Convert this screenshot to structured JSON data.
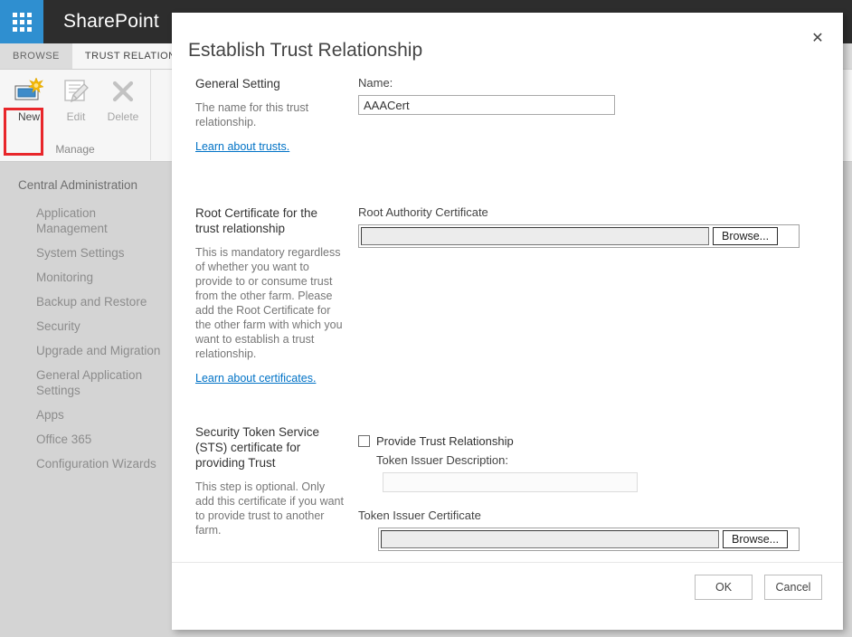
{
  "suite_bar": {
    "app_launcher_icon": "waffle-grid-icon",
    "brand": "SharePoint"
  },
  "ribbon": {
    "tabs": [
      {
        "label": "BROWSE",
        "active": false
      },
      {
        "label": "TRUST RELATIONSHIP",
        "active": true
      }
    ],
    "group_label": "Manage",
    "buttons": [
      {
        "label": "New",
        "icon": "new-item-icon",
        "enabled": true,
        "highlighted": true
      },
      {
        "label": "Edit",
        "icon": "edit-pencil-icon",
        "enabled": false,
        "highlighted": false
      },
      {
        "label": "Delete",
        "icon": "delete-x-icon",
        "enabled": false,
        "highlighted": false
      }
    ],
    "highlight_color": "#e8262a"
  },
  "left_nav": {
    "header": "Central Administration",
    "items": [
      "Application Management",
      "System Settings",
      "Monitoring",
      "Backup and Restore",
      "Security",
      "Upgrade and Migration",
      "General Application Settings",
      "Apps",
      "Office 365",
      "Configuration Wizards"
    ]
  },
  "dialog": {
    "title": "Establish Trust Relationship",
    "close_icon": "close-icon",
    "sections": {
      "general": {
        "heading": "General Setting",
        "description": "The name for this trust relationship.",
        "link": "Learn about trusts.",
        "name_label": "Name:",
        "name_value": "AAACert",
        "name_placeholder": ""
      },
      "root_cert": {
        "heading": "Root Certificate for the trust relationship",
        "description": "This is mandatory regardless of whether you want to provide to or consume trust from the other farm. Please add the Root Certificate for the other farm with which you want to establish a trust relationship.",
        "link": "Learn about certificates.",
        "field_label": "Root Authority Certificate",
        "field_value": "",
        "browse_label": "Browse..."
      },
      "sts_cert": {
        "heading": "Security Token Service (STS) certificate for providing Trust",
        "description": "This step is optional. Only add this certificate if you want to provide trust to another farm.",
        "checkbox_label": "Provide Trust Relationship",
        "checkbox_checked": false,
        "issuer_desc_label": "Token Issuer Description:",
        "issuer_desc_value": "",
        "issuer_cert_label": "Token Issuer Certificate",
        "issuer_cert_value": "",
        "browse_label": "Browse..."
      }
    },
    "footer": {
      "ok_label": "OK",
      "cancel_label": "Cancel"
    }
  },
  "colors": {
    "suite_bar_bg": "#2d2d2d",
    "app_launcher_bg": "#2f8fd0",
    "page_bg": "#d4d4d4",
    "link": "#0072c6",
    "highlight": "#e8262a"
  }
}
